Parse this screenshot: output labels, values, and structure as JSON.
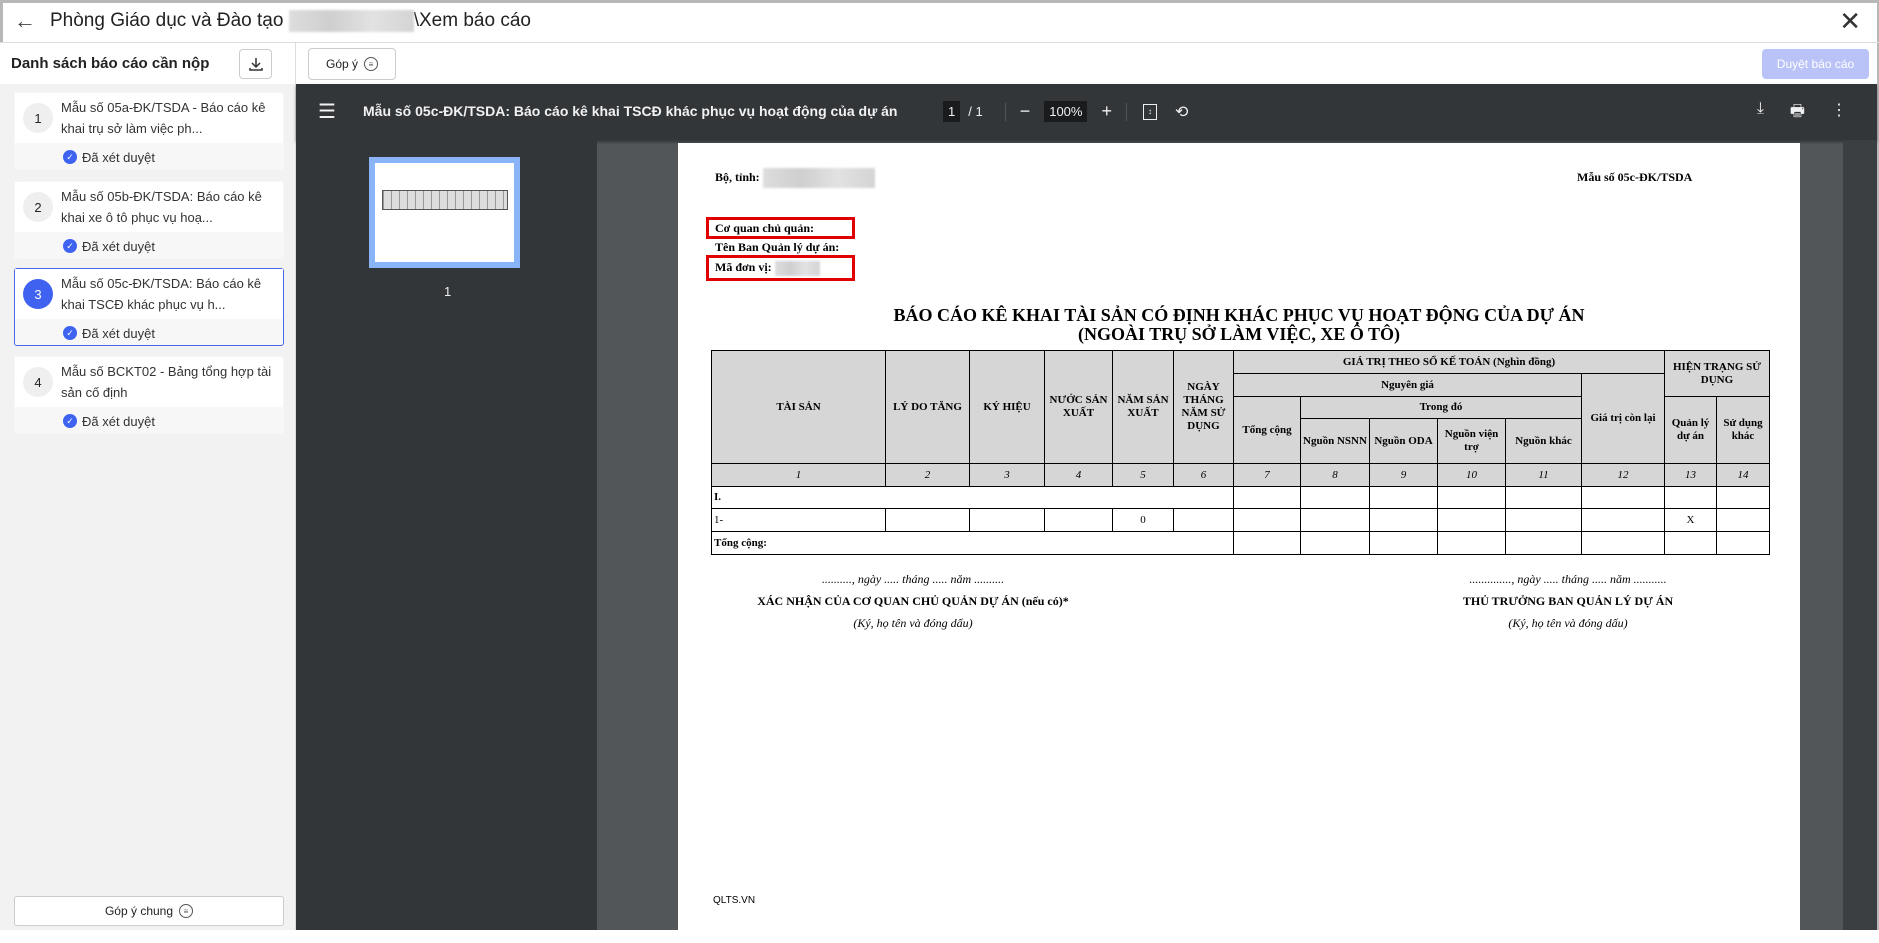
{
  "header": {
    "title_prefix": "Phòng Giáo dục và Đào tạo",
    "title_suffix": "\\Xem báo cáo"
  },
  "sidebar": {
    "title": "Danh sách báo cáo cần nộp",
    "items": [
      {
        "num": "1",
        "title": "Mẫu số 05a-ĐK/TSDA - Báo cáo kê khai trụ sở làm việc ph...",
        "status": "Đã xét duyệt"
      },
      {
        "num": "2",
        "title": "Mẫu số 05b-ĐK/TSDA: Báo cáo kê khai xe ô tô phục vụ hoạ...",
        "status": "Đã xét duyệt"
      },
      {
        "num": "3",
        "title": "Mẫu số 05c-ĐK/TSDA: Báo cáo kê khai TSCĐ khác phục vụ h...",
        "status": "Đã xét duyệt"
      },
      {
        "num": "4",
        "title": "Mẫu số BCKT02 - Bảng tổng hợp tài sản cố định",
        "status": "Đã xét duyệt"
      }
    ],
    "feedback_all": "Góp ý chung"
  },
  "toolbar": {
    "feedback": "Góp ý",
    "approve": "Duyệt báo cáo"
  },
  "viewer": {
    "doc_title": "Mẫu số 05c-ĐK/TSDA: Báo cáo kê khai TSCĐ khác phục vụ hoạt động của dự án",
    "page": "1",
    "total": "/  1",
    "zoom": "100%",
    "thumb_label": "1"
  },
  "doc": {
    "bo_tinh": "Bộ, tỉnh:",
    "form_code": "Mẫu số 05c-ĐK/TSDA",
    "co_quan": "Cơ quan chủ quản:",
    "ten_ban": "Tên Ban Quản lý dự án:",
    "ma_don_vi": "Mã đơn vị:",
    "title1": "BÁO CÁO KÊ KHAI TÀI SẢN CÓ ĐỊNH KHÁC PHỤC VỤ HOẠT ĐỘNG CỦA DỰ ÁN",
    "title2": "(NGOÀI TRỤ SỞ LÀM VIỆC, XE Ô TÔ)",
    "h": {
      "tai_san": "TÀI SẢN",
      "ly_do": "LÝ DO TĂNG",
      "ky_hieu": "KÝ HIỆU",
      "nuoc": "NƯỚC SẢN XUẤT",
      "nam": "NĂM SẢN XUẤT",
      "ngay": "NGÀY THÁNG NĂM SỬ DỤNG",
      "gia_tri": "GIÁ TRỊ THEO SỔ KẾ TOÁN (Nghìn đồng)",
      "hien_trang": "HIỆN TRẠNG SỬ DỤNG",
      "nguyen_gia": "Nguyên giá",
      "con_lai": "Giá trị còn lại",
      "tong_cong": "Tổng cộng",
      "trong_do": "Trong đó",
      "quan_ly": "Quản lý dự án",
      "su_dung": "Sử dụng khác",
      "nsnn": "Nguồn NSNN",
      "oda": "Nguồn ODA",
      "vien_tro": "Nguồn viện trợ",
      "khac": "Nguồn khác"
    },
    "col_nums": [
      "1",
      "2",
      "3",
      "4",
      "5",
      "6",
      "7",
      "8",
      "9",
      "10",
      "11",
      "12",
      "13",
      "14"
    ],
    "row_I": "I.",
    "row_1": {
      "name": "1-",
      "nam": "0",
      "quan_ly": "X"
    },
    "total": "Tổng cộng:",
    "left_sig": {
      "date": ".........., ngày ..... tháng ..... năm ..........",
      "title": "XÁC NHẬN CỦA CƠ QUAN CHỦ QUẢN DỰ ÁN (nếu có)*",
      "note": "(Ký, họ tên và đóng dấu)"
    },
    "right_sig": {
      "date": ".............., ngày ..... tháng ..... năm ...........",
      "title": "THỦ TRƯỞNG BAN QUẢN LÝ DỰ ÁN",
      "note": "(Ký, họ tên và đóng dấu)"
    },
    "footer": "QLTS.VN"
  }
}
